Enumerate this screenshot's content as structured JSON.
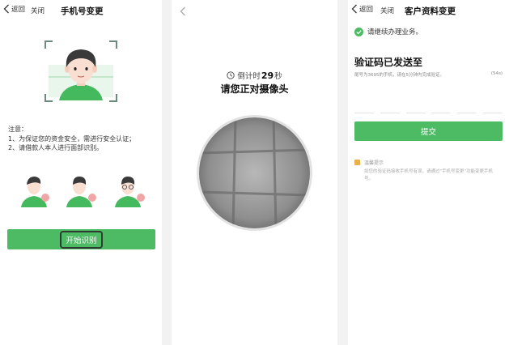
{
  "screen1": {
    "back_label": "返回",
    "close_label": "关闭",
    "title": "手机号变更",
    "notice_title": "注意：",
    "notice_items": [
      "1、为保证您的资金安全，需进行安全认证；",
      "2、请借款人本人进行面部识别。"
    ],
    "start_button": "开始识别"
  },
  "screen2": {
    "countdown_prefix": "倒计时",
    "countdown_value": "29",
    "countdown_unit": "秒",
    "instruction": "请您正对摄像头"
  },
  "screen3": {
    "back_label": "返回",
    "close_label": "关闭",
    "title": "客户资料变更",
    "status": "请继续办理业务。",
    "code_title": "验证码已发送至",
    "code_desc": "尾号为3695的手机，请在5分钟内完成验证。",
    "code_timer": "(54s)",
    "submit_button": "提交",
    "tip_title": "温馨提示",
    "tip_body": "如您的验证码接收手机号有误，请通过\"手机号变更\"功能变更手机号。"
  },
  "colors": {
    "brand_green": "#4cbb64",
    "shirt_green": "#45b95e"
  }
}
